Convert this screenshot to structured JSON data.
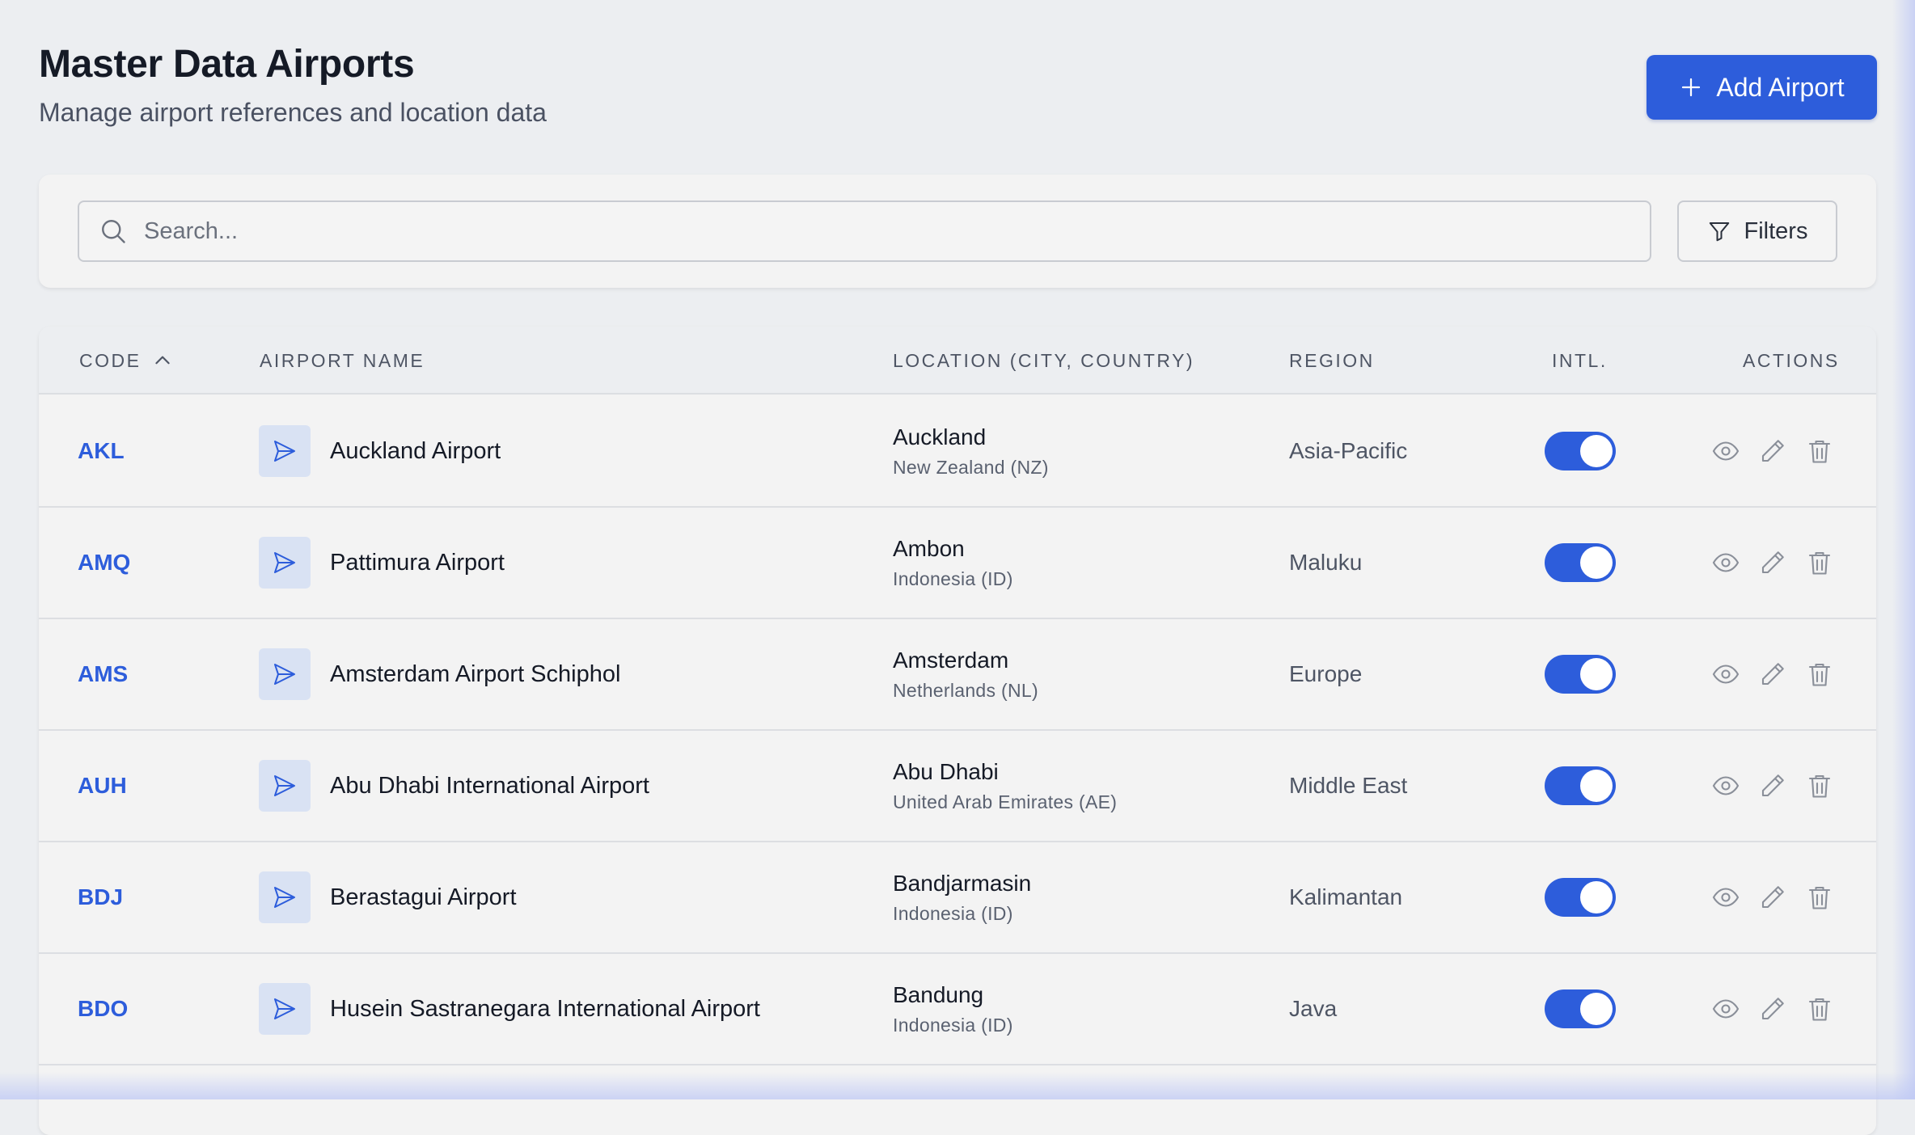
{
  "header": {
    "title": "Master Data Airports",
    "subtitle": "Manage airport references and location data"
  },
  "actions": {
    "add_label": "Add Airport",
    "add_icon": "plus-icon"
  },
  "search": {
    "placeholder": "Search...",
    "value": "",
    "filters_label": "Filters",
    "search_icon": "search-icon",
    "filter_icon": "filter-icon"
  },
  "table": {
    "columns": {
      "code": "CODE",
      "name": "AIRPORT NAME",
      "location": "LOCATION (CITY, COUNTRY)",
      "region": "REGION",
      "intl": "INTL.",
      "actions": "ACTIONS"
    },
    "sort": {
      "column": "code",
      "direction": "asc"
    },
    "rows": [
      {
        "code": "AKL",
        "name": "Auckland Airport",
        "city": "Auckland",
        "country": "New Zealand (NZ)",
        "region": "Asia-Pacific",
        "intl": true
      },
      {
        "code": "AMQ",
        "name": "Pattimura Airport",
        "city": "Ambon",
        "country": "Indonesia (ID)",
        "region": "Maluku",
        "intl": true
      },
      {
        "code": "AMS",
        "name": "Amsterdam Airport Schiphol",
        "city": "Amsterdam",
        "country": "Netherlands (NL)",
        "region": "Europe",
        "intl": true
      },
      {
        "code": "AUH",
        "name": "Abu Dhabi International Airport",
        "city": "Abu Dhabi",
        "country": "United Arab Emirates (AE)",
        "region": "Middle East",
        "intl": true
      },
      {
        "code": "BDJ",
        "name": "Berastagui Airport",
        "city": "Bandjarmasin",
        "country": "Indonesia (ID)",
        "region": "Kalimantan",
        "intl": true
      },
      {
        "code": "BDO",
        "name": "Husein Sastranegara International Airport",
        "city": "Bandung",
        "country": "Indonesia (ID)",
        "region": "Java",
        "intl": true
      }
    ]
  },
  "colors": {
    "accent": "#2d5ddb",
    "background": "#eceef1",
    "card": "#f3f3f3",
    "muted_text": "#4e5564"
  }
}
